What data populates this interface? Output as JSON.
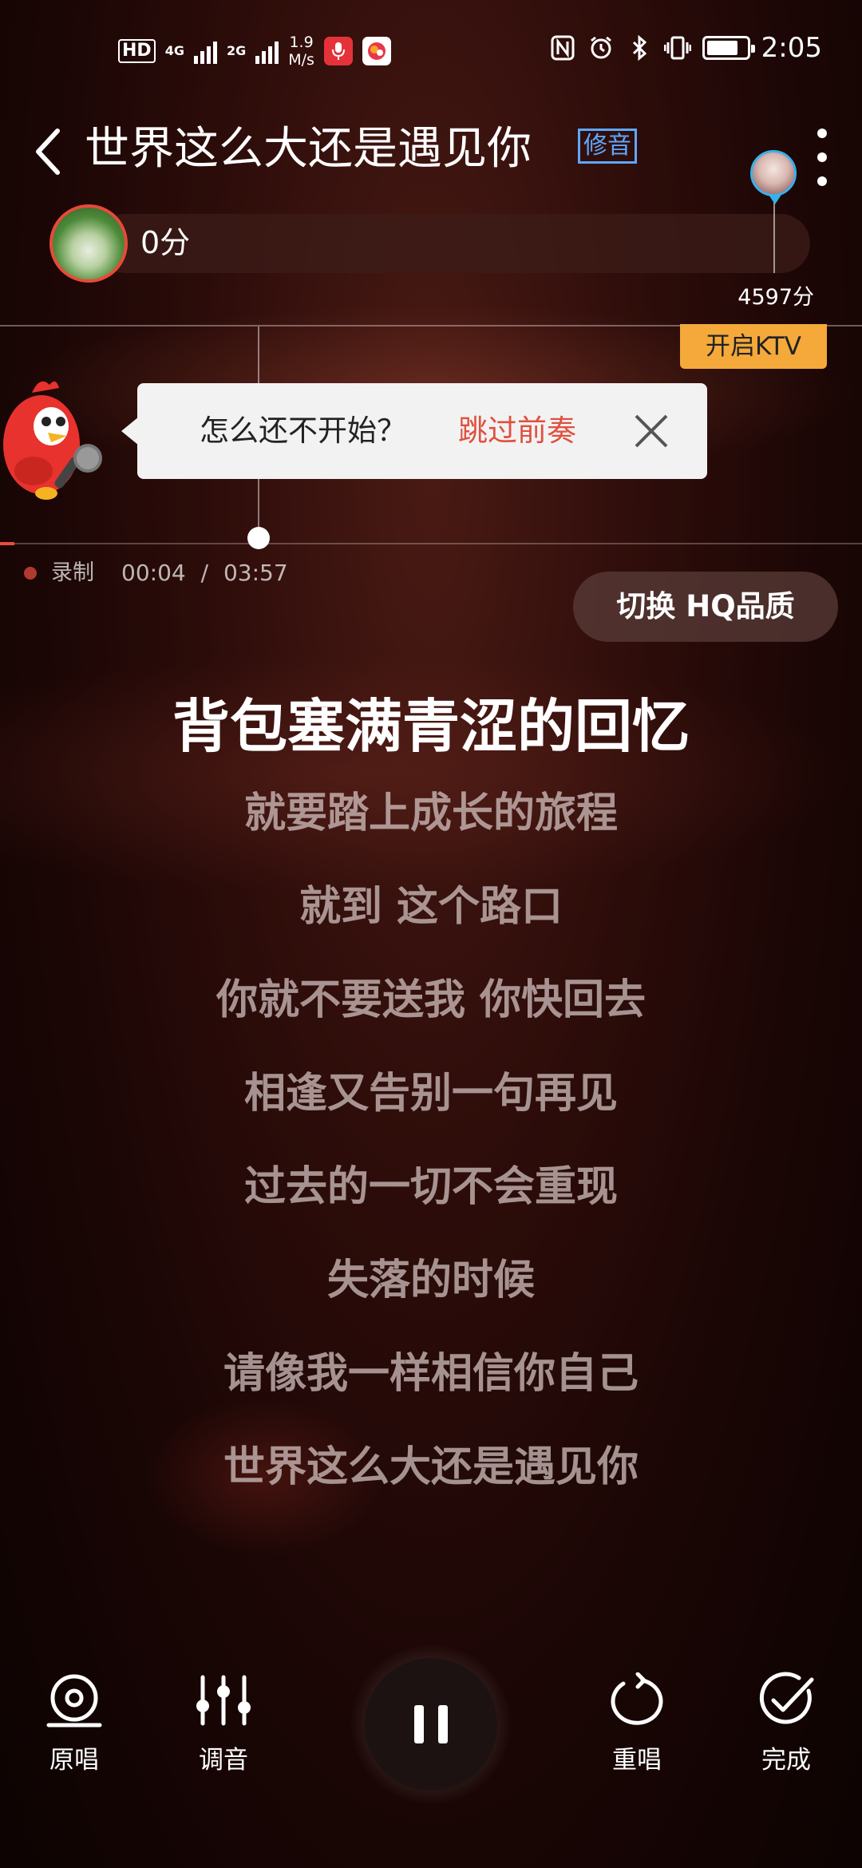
{
  "status_bar": {
    "hd_badge": "HD",
    "net1": "4G",
    "net2": "2G",
    "speed_value": "1.9",
    "speed_unit": "M/s",
    "time": "2:05"
  },
  "header": {
    "title": "世界这么大还是遇见你",
    "tune_badge": "修音"
  },
  "score": {
    "current": "0分",
    "target": "4597分"
  },
  "ktv_button": "开启KTV",
  "tip_bubble": {
    "question": "怎么还不开始？",
    "skip_label": "跳过前奏"
  },
  "recording": {
    "label": "录制",
    "elapsed": "00:04",
    "separator": "/",
    "total": "03:57",
    "progress_fraction": 0.017
  },
  "quality_button": "切换 HQ品质",
  "lyrics": {
    "current": "背包塞满青涩的回忆",
    "upcoming": [
      "就要踏上成长的旅程",
      "就到 这个路口",
      "你就不要送我 你快回去",
      "相逢又告别一句再见",
      "过去的一切不会重现",
      "失落的时候",
      "请像我一样相信你自己",
      "世界这么大还是遇见你"
    ]
  },
  "controls": {
    "original": "原唱",
    "tune": "调音",
    "restart": "重唱",
    "finish": "完成"
  },
  "colors": {
    "accent_red": "#e0503e",
    "ktv_orange": "#f4a93a",
    "badge_blue": "#5fa8ff"
  }
}
